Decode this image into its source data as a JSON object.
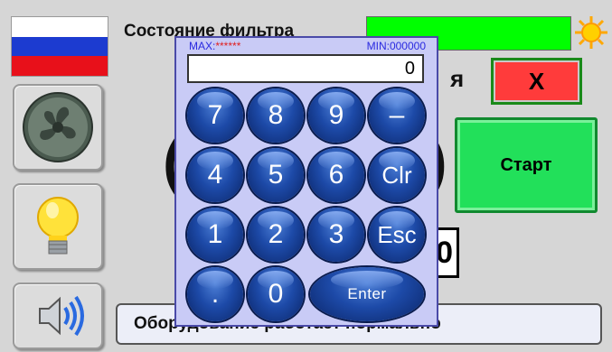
{
  "header": {
    "filter_label": "Состояние фильтра",
    "heading_tail": "я",
    "close_label": "X"
  },
  "controls": {
    "start_label": "Старт",
    "big_left": "(",
    "big_right": ")",
    "small_field_value": "0"
  },
  "status": {
    "message": "Оборудование работает нормально"
  },
  "keypad": {
    "max_label": "MAX:",
    "max_value": "******",
    "min_label": "MIN:",
    "min_value": "000000",
    "display_value": "0",
    "keys": [
      "7",
      "8",
      "9",
      "–",
      "4",
      "5",
      "6",
      "Clr",
      "1",
      "2",
      "3",
      "Esc",
      ".",
      "0",
      "Enter"
    ]
  },
  "colors": {
    "filter_ok": "#00ff00",
    "close": "#ff3b3b",
    "start": "#22e05a",
    "keypad_bg": "#c9cbf6"
  },
  "icons": {
    "flag": "russia-flag-icon",
    "fan": "fan-icon",
    "light": "light-bulb-icon",
    "sound": "speaker-icon",
    "status_indicator": "sun-icon"
  }
}
